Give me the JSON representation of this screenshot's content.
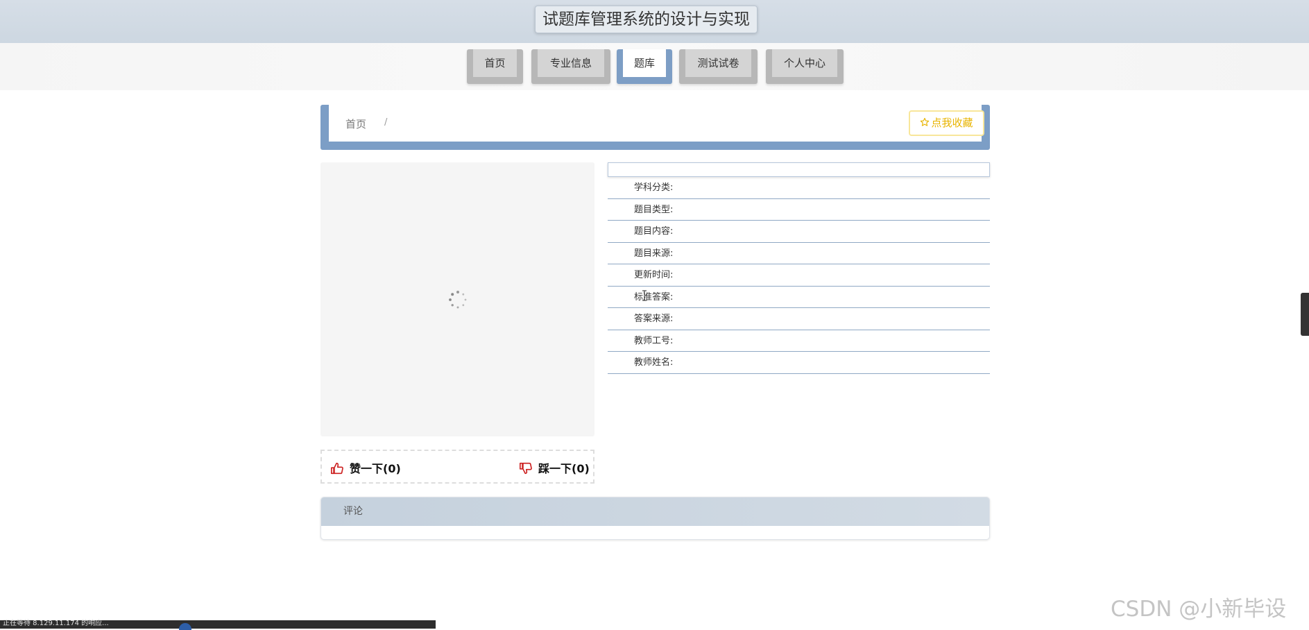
{
  "header": {
    "title": "试题库管理系统的设计与实现"
  },
  "nav": {
    "items": [
      {
        "label": "首页",
        "active": false
      },
      {
        "label": "专业信息",
        "active": false
      },
      {
        "label": "题库",
        "active": true
      },
      {
        "label": "测试试卷",
        "active": false
      },
      {
        "label": "个人中心",
        "active": false
      }
    ]
  },
  "breadcrumb": {
    "home": "首页",
    "separator": "/"
  },
  "favorite": {
    "icon": "star-outline-icon",
    "label": "点我收藏"
  },
  "votes": {
    "up_label": "赞一下(0)",
    "down_label": "踩一下(0)"
  },
  "details": {
    "title": "",
    "fields": [
      {
        "label": "学科分类:",
        "value": ""
      },
      {
        "label": "题目类型:",
        "value": ""
      },
      {
        "label": "题目内容:",
        "value": ""
      },
      {
        "label": "题目来源:",
        "value": ""
      },
      {
        "label": "更新时间:",
        "value": ""
      },
      {
        "label": "标准答案:",
        "value": ""
      },
      {
        "label": "答案来源:",
        "value": ""
      },
      {
        "label": "教师工号:",
        "value": ""
      },
      {
        "label": "教师姓名:",
        "value": ""
      }
    ]
  },
  "comment": {
    "title": "评论"
  },
  "status_bar": {
    "text": "正在等待 8.129.11.174 的响应..."
  },
  "watermark": "CSDN @小新毕设",
  "colors": {
    "header_bg": "#d2dbe4",
    "nav_active": "#7d9ec5",
    "nav_inactive": "#b7b7b7",
    "accent_blue": "#7c9ec6",
    "favorite_yellow": "#e8b400",
    "vote_red": "#cc1f1f"
  }
}
